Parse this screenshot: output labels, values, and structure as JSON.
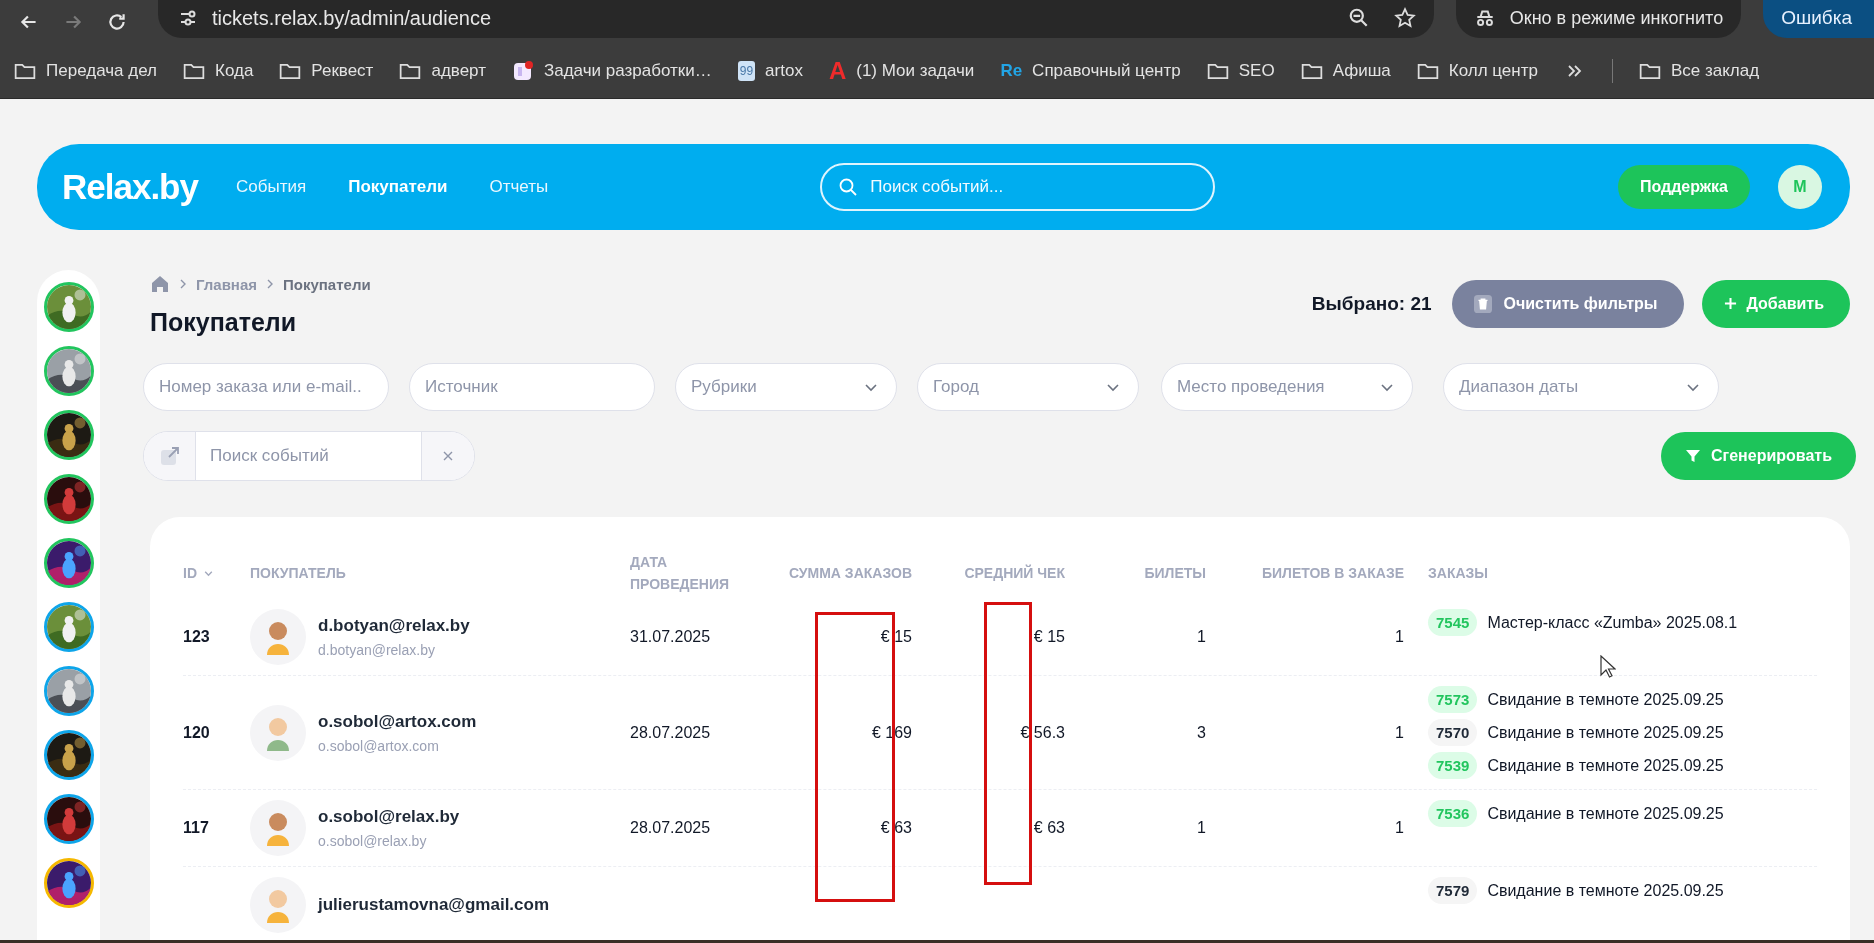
{
  "browser": {
    "url": "tickets.relax.by/admin/audience",
    "incognito_label": "Окно в режиме инкогнито",
    "error_label": "Ошибка",
    "bookmarks": [
      {
        "kind": "folder",
        "label": "Передача дел"
      },
      {
        "kind": "folder",
        "label": "Кода"
      },
      {
        "kind": "folder",
        "label": "Реквест"
      },
      {
        "kind": "folder",
        "label": "адверт"
      },
      {
        "kind": "app",
        "label": "Задачи разработки…"
      },
      {
        "kind": "badge",
        "icon_text": "99",
        "label": "artox"
      },
      {
        "kind": "letter",
        "icon_text": "A",
        "label": "(1) Мои задачи"
      },
      {
        "kind": "logo",
        "icon_text": "Re",
        "label": "Справочный центр"
      },
      {
        "kind": "folder",
        "label": "SEO"
      },
      {
        "kind": "folder",
        "label": "Афиша"
      },
      {
        "kind": "folder",
        "label": "Колл центр"
      }
    ],
    "all_bookmarks": "Все заклад"
  },
  "header": {
    "logo": "Relax.by",
    "nav": [
      {
        "label": "События",
        "selected": false
      },
      {
        "label": "Покупатели",
        "selected": true
      },
      {
        "label": "Отчеты",
        "selected": false
      }
    ],
    "search_placeholder": "Поиск событий...",
    "support": "Поддержка",
    "user_initial": "M"
  },
  "sidebar": {
    "thumbnails": [
      {
        "color": "#22c55e"
      },
      {
        "color": "#22c55e"
      },
      {
        "color": "#22c55e"
      },
      {
        "color": "#22c55e"
      },
      {
        "color": "#22c55e"
      },
      {
        "color": "#0ea5e9"
      },
      {
        "color": "#0ea5e9"
      },
      {
        "color": "#0ea5e9"
      },
      {
        "color": "#0ea5e9"
      },
      {
        "color": "#f5b800"
      }
    ]
  },
  "page": {
    "breadcrumb": [
      "Главная",
      "Покупатели"
    ],
    "title": "Покупатели",
    "selected_count": "Выбрано: 21",
    "clear_button": "Очистить фильтры",
    "add_button": "Добавить"
  },
  "filters": [
    {
      "kind": "text",
      "placeholder": "Номер заказа или e-mail.."
    },
    {
      "kind": "text",
      "placeholder": "Источник"
    },
    {
      "kind": "select",
      "placeholder": "Рубрики"
    },
    {
      "kind": "select",
      "placeholder": "Город"
    },
    {
      "kind": "select",
      "placeholder": "Место проведения"
    },
    {
      "kind": "select",
      "placeholder": "Диапазон даты"
    }
  ],
  "event_search": {
    "placeholder": "Поиск событий"
  },
  "generate_button": "Сгенерировать",
  "table": {
    "columns": [
      {
        "label": "ID",
        "sorted": true
      },
      {
        "label": "ПОКУПАТЕЛЬ",
        "sorted": false
      },
      {
        "label": "ДАТА ПРОВЕДЕНИЯ",
        "sorted": false
      },
      {
        "label": "СУММА ЗАКАЗОВ",
        "sorted": false
      },
      {
        "label": "СРЕДНИЙ ЧЕК",
        "sorted": false
      },
      {
        "label": "БИЛЕТЫ",
        "sorted": false
      },
      {
        "label": "БИЛЕТОВ В ЗАКАЗЕ",
        "sorted": false
      },
      {
        "label": "ЗАКАЗЫ",
        "sorted": false
      }
    ],
    "rows": [
      {
        "id": "123",
        "name": "d.botyan@relax.by",
        "email": "d.botyan@relax.by",
        "date": "31.07.2025",
        "total": "€ 15",
        "average": "€ 15",
        "tickets": "1",
        "tickets_per_order": "1",
        "orders": [
          {
            "number": "7545",
            "title": "Мастер-класс «Zumba» 2025.08.1",
            "color": "#22c55e"
          }
        ]
      },
      {
        "id": "120",
        "name": "o.sobol@artox.com",
        "email": "o.sobol@artox.com",
        "date": "28.07.2025",
        "total": "€ 169",
        "average": "€ 56.3",
        "tickets": "3",
        "tickets_per_order": "1",
        "orders": [
          {
            "number": "7573",
            "title": "Свидание в темноте 2025.09.25",
            "color": "#22c55e"
          },
          {
            "number": "7570",
            "title": "Свидание в темноте 2025.09.25",
            "color": "#1f2937"
          },
          {
            "number": "7539",
            "title": "Свидание в темноте 2025.09.25",
            "color": "#22c55e"
          }
        ]
      },
      {
        "id": "117",
        "name": "o.sobol@relax.by",
        "email": "o.sobol@relax.by",
        "date": "28.07.2025",
        "total": "€ 63",
        "average": "€ 63",
        "tickets": "1",
        "tickets_per_order": "1",
        "orders": [
          {
            "number": "7536",
            "title": "Свидание в темноте 2025.09.25",
            "color": "#22c55e"
          }
        ]
      },
      {
        "name": "julierustamovna@gmail.com",
        "orders": [
          {
            "number": "7579",
            "title": "Свидание в темноте 2025.09.25",
            "color": "#1f2937"
          }
        ]
      }
    ]
  }
}
